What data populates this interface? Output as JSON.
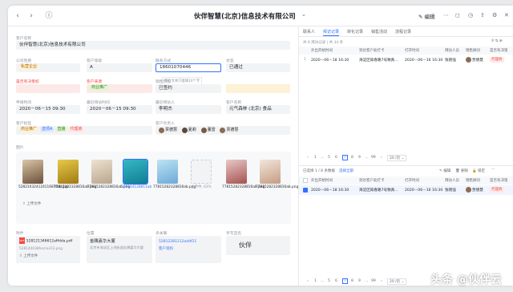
{
  "window": {
    "title": "伙伴智慧(北京)信息技术有限公司",
    "edit_label": "编辑"
  },
  "form": {
    "customer_name": {
      "label": "客户名称",
      "value": "伙伴智慧(北京)信息技术有限公司"
    },
    "company_nature": {
      "label": "公司性质",
      "value": "私营企业"
    },
    "customer_level": {
      "label": "客户等级",
      "value": "A"
    },
    "contact": {
      "label": "联系方式",
      "value": "18601070446",
      "hint": "单行文本只能填10个字"
    },
    "status": {
      "label": "状态",
      "value": "已通过"
    },
    "decision_maker": {
      "label": "是否有决策权",
      "value": ""
    },
    "customer_source": {
      "label": "客户来源",
      "value": "商业推广"
    },
    "sales_stage": {
      "label": "销售阶段",
      "value": "已签约"
    },
    "apply_time": {
      "label": "申请时间",
      "value": "2020－06－15 09:30"
    },
    "latest_visit_time": {
      "label": "最近拜访时间",
      "value": "2020－06－15 09:30"
    },
    "latest_visitor": {
      "label": "最近拜访人",
      "value": "李明杰"
    },
    "customer_company": {
      "label": "客户名称",
      "value": "元气森林 (北京) 食品"
    },
    "customer_tags": {
      "label": "客户标签",
      "tags": [
        "商业推广",
        "选项A",
        "直播",
        "代理商"
      ]
    },
    "owners": {
      "label": "客户负责人",
      "people": [
        "贾德慧",
        "夏莉",
        "董雷",
        "贾德慧"
      ]
    },
    "pictures": {
      "label": "图片",
      "items": [
        {
          "name": "52821032412411681tab.jpg"
        },
        {
          "name": "77815282328816ab.png"
        },
        {
          "name": "77815282328816ab.png"
        },
        {
          "name": "528144128811ab"
        },
        {
          "name": "77815282328816ab.png"
        },
        {
          "name": "上传中, 63%"
        },
        {
          "name": "77815282328816ab.png"
        },
        {
          "name": "77815282328816ab.png"
        }
      ],
      "upload_label": "上传文件"
    },
    "attachment": {
      "label": "附件",
      "name": "528121346612affdda.pdf",
      "sub": "528144038hocnul13.png",
      "upload_label": "上传文件"
    },
    "location": {
      "label": "位置",
      "place": "金隅嘉华大厦",
      "address": "北京市海淀区上地街道金隅嘉华大厦"
    },
    "related": {
      "label": "多关联",
      "line1": "52812281212addf11",
      "line2": "客户资料"
    },
    "signature": {
      "label": "手写签名",
      "value": "伙伴"
    }
  },
  "right": {
    "tabs": [
      "联系人",
      "拜访记录",
      "转化记录",
      "销售活动",
      "流程记录"
    ],
    "active_tab": 1,
    "summary": "共 8 拜访记录  |  共 34 条",
    "columns": [
      "",
      "外出开始时间",
      "到达客户处打卡",
      "打开时间",
      "拜访人员",
      "销售顾问",
      "是否有决策"
    ],
    "top_rows": [
      {
        "index": "1",
        "start": "2020－06－18 16:30",
        "arrive": "海淀区知春路7号致真...",
        "open": "2020－06－16 16:30",
        "visitor": "张晓强",
        "advisor": "贾德慧",
        "decision": "代理商"
      }
    ],
    "pager": {
      "pages": [
        "1",
        "5",
        "6",
        "7",
        "8",
        "9",
        "99"
      ],
      "current": "7",
      "size": "20 /页"
    },
    "selection_bar": {
      "selected": "已选择 1 / 8 条数据",
      "select_all": "选择全部",
      "edit": "编辑",
      "delete": "删除",
      "lock": "锁定"
    },
    "bottom_rows": [
      {
        "checked": true,
        "start": "2020－06－18 16:30",
        "arrive": "海淀区知春路7号致真...",
        "open": "2020－06－16 16:30",
        "visitor": "张晓强",
        "advisor": "贾德慧",
        "decision": "代理商"
      }
    ]
  },
  "colors": {
    "accent": "#3370ff",
    "tag_red": "#f54a45",
    "tag_green": "#34c724"
  },
  "watermark": "头条 @伙伴云"
}
